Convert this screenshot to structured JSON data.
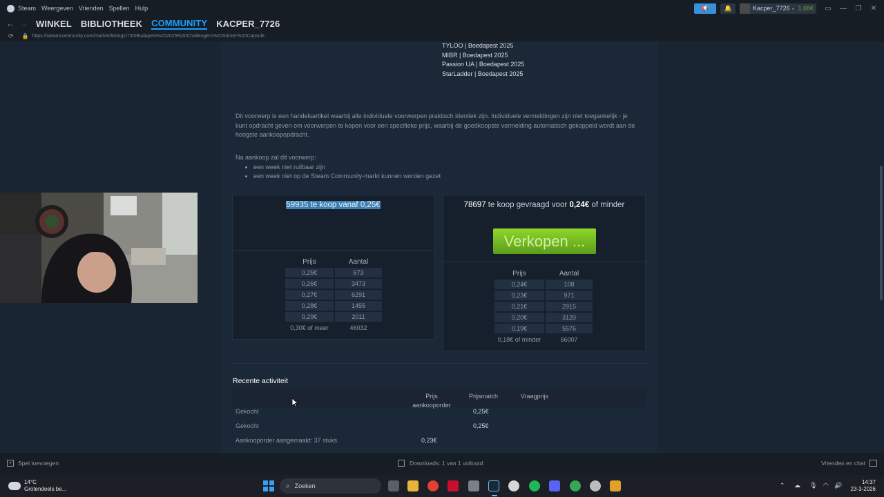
{
  "topbar": {
    "app_name": "Steam",
    "menu": [
      "Weergeven",
      "Vrienden",
      "Spellen",
      "Hulp"
    ],
    "account_name": "Kacper_7726",
    "wallet": "1,68€"
  },
  "nav": {
    "links": [
      "WINKEL",
      "BIBLIOTHEEK",
      "COMMUNITY",
      "KACPER_7726"
    ],
    "active": "COMMUNITY"
  },
  "url": "https://steamcommunity.com/market/listings/730/Budapest%202025%20Challengers%20Sticker%20Capsule",
  "stickers": [
    "TYLOO | Boedapest 2025",
    "MIBR | Boedapest 2025",
    "Passion UA | Boedapest 2025",
    "StarLadder | Boedapest 2025"
  ],
  "description": "Dit voorwerp is een handelsartikel waarbij alle individuele voorwerpen praktisch identiek zijn. Individuele vermeldingen zijn niet toegankelijk - je kunt opdracht geven om voorwerpen te kopen voor een specifieke prijs, waarbij de goedkoopste vermelding automatisch gekoppeld wordt aan de hoogste aankoopopdracht.",
  "after_purchase": {
    "intro": "Na aankoop zal dit voorwerp:",
    "items": [
      "een week niet ruilbaar zijn",
      "een week niet op de Steam Community-markt kunnen worden gezet"
    ]
  },
  "sell_orders": {
    "count": "59935",
    "mid_text": "te koop vanaf",
    "price": "0,25€",
    "col_price": "Prijs",
    "col_qty": "Aantal",
    "rows": [
      {
        "price": "0,25€",
        "qty": "673"
      },
      {
        "price": "0,26€",
        "qty": "3473"
      },
      {
        "price": "0,27€",
        "qty": "6291"
      },
      {
        "price": "0,28€",
        "qty": "1455"
      },
      {
        "price": "0,29€",
        "qty": "2011"
      },
      {
        "price": "0,30€ of meer",
        "qty": "46032"
      }
    ]
  },
  "buy_orders": {
    "count": "78697",
    "mid_text": "te koop gevraagd voor",
    "price": "0,24€",
    "suffix": "of minder",
    "sell_button": "Verkopen ...",
    "col_price": "Prijs",
    "col_qty": "Aantal",
    "rows": [
      {
        "price": "0,24€",
        "qty": "108"
      },
      {
        "price": "0,23€",
        "qty": "971"
      },
      {
        "price": "0,21€",
        "qty": "2915"
      },
      {
        "price": "0,20€",
        "qty": "3120"
      },
      {
        "price": "0,19€",
        "qty": "5576"
      },
      {
        "price": "0,18€ of minder",
        "qty": "66007"
      }
    ]
  },
  "recent": {
    "title": "Recente activiteit",
    "col_buyorder": "Prijs aankooporder",
    "col_match": "Prijsmatch",
    "col_ask": "Vraagprijs",
    "rows": [
      {
        "label": "Gekocht",
        "match": "0,25€"
      },
      {
        "label": "Gekocht",
        "match": "0,25€"
      },
      {
        "label": "Aankooporder aangemaakt: 37 stuks",
        "buyorder": "0,23€"
      }
    ]
  },
  "statusbar": {
    "add_game": "Spel toevoegen",
    "downloads": "Downloads: 1 van 1 voltooid",
    "friends": "Vrienden en chat"
  },
  "taskbar": {
    "temp": "14°C",
    "weather": "Grotendeels be...",
    "search": "Zoeken",
    "time": "14:37",
    "date": "23-3-2026"
  },
  "colors": {
    "accent": "#1a9fff",
    "sell_button": "#75b022",
    "panel": "#1b2838"
  }
}
